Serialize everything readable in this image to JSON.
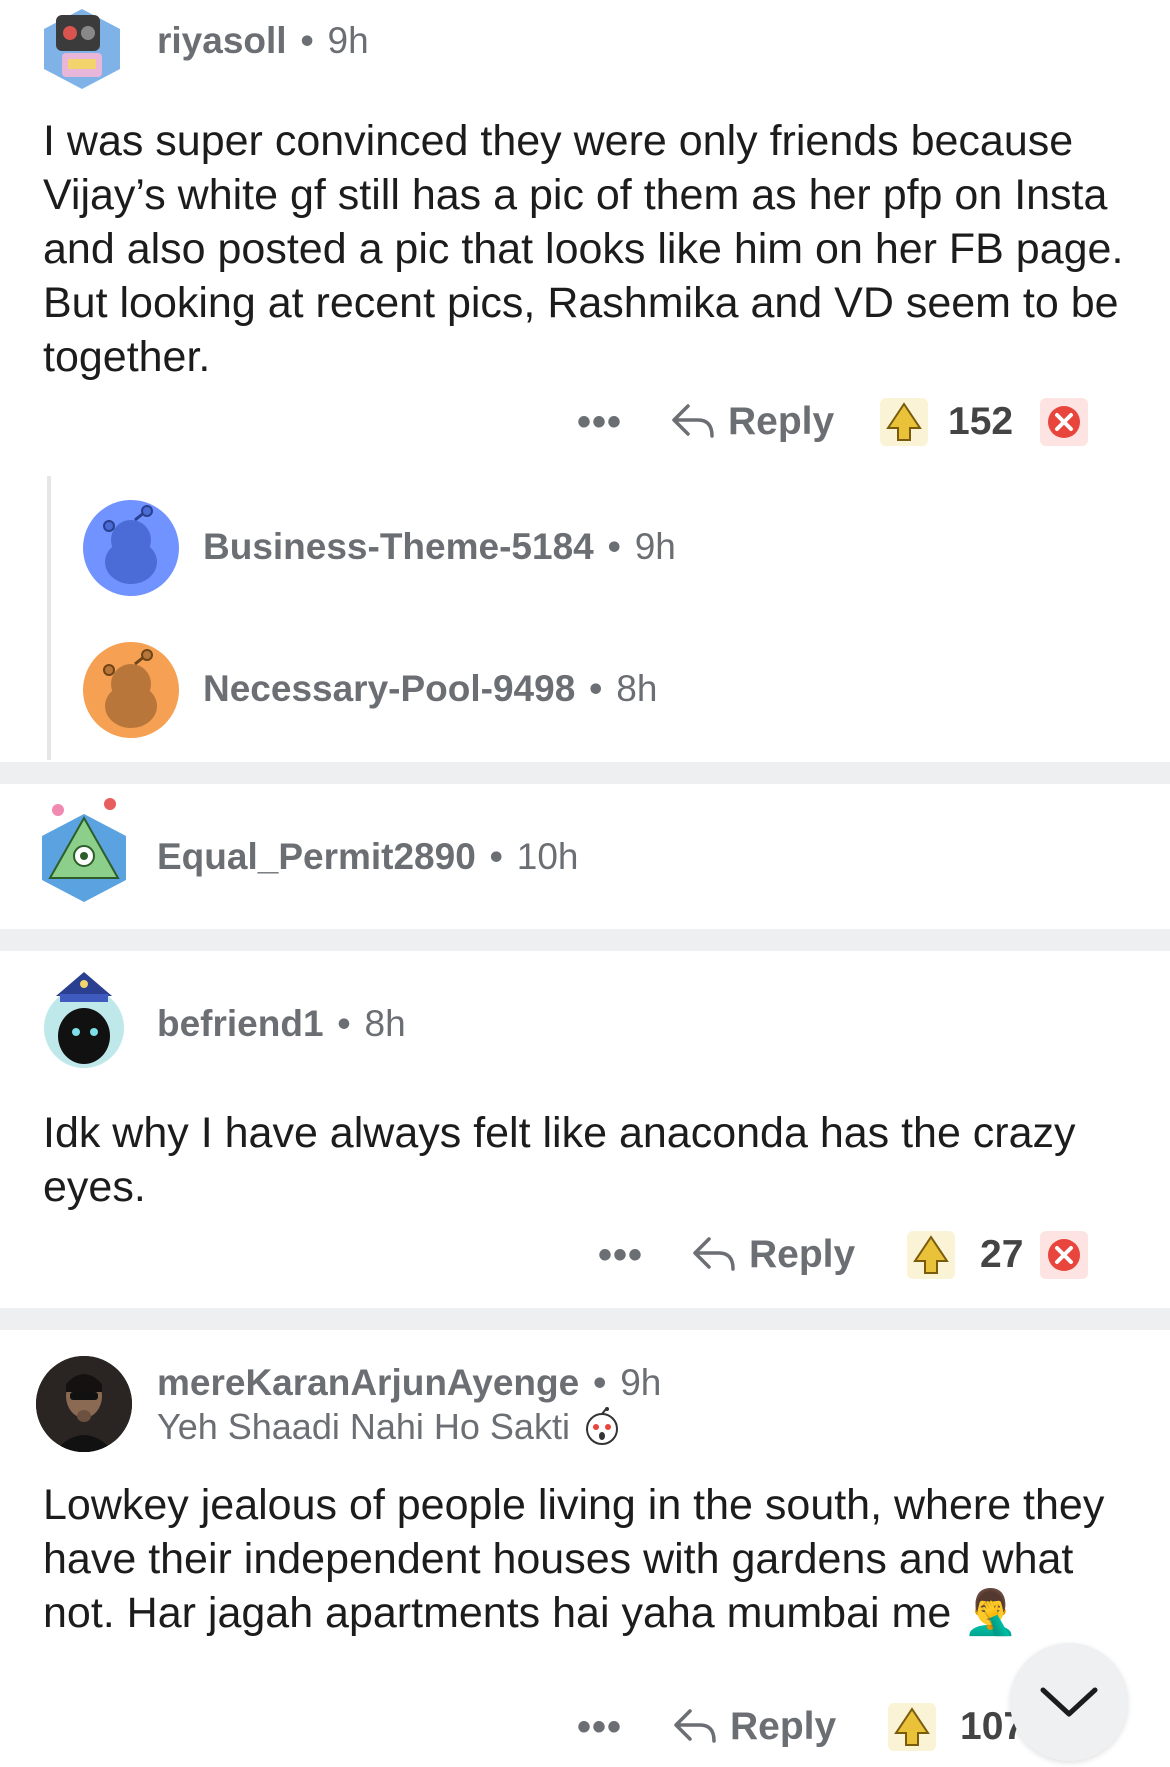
{
  "comments": [
    {
      "username": "riyasoll",
      "time": "9h",
      "body": "I was super convinced they were only friends because Vijay’s white gf still has a pic of them as her pfp on Insta and also posted a pic that looks like him on her FB page. But looking at recent pics, Rashmika and VD seem to be together.",
      "more": "•••",
      "reply_label": "Reply",
      "votes": "152"
    },
    {
      "username": "Business-Theme-5184",
      "time": "9h",
      "avatar_color": "#7193ff"
    },
    {
      "username": "Necessary-Pool-9498",
      "time": "8h",
      "avatar_color": "#f5a052"
    },
    {
      "username": "Equal_Permit2890",
      "time": "10h"
    },
    {
      "username": "befriend1",
      "time": "8h",
      "body": "Idk why I have always felt like anaconda has the crazy eyes.",
      "more": "•••",
      "reply_label": "Reply",
      "votes": "27"
    },
    {
      "username": "mereKaranArjunAyenge",
      "time": "9h",
      "flair": "Yeh Shaadi Nahi Ho Sakti",
      "body": "Lowkey jealous of people living in the south, where they have their independent houses with gardens and what not. Har jagah apartments hai yaha mumbai me",
      "body_emoji": "🤦‍♂️",
      "more": "•••",
      "reply_label": "Reply",
      "votes": "107"
    }
  ],
  "dot": "•",
  "icons": {
    "reply": "reply-arrow-icon",
    "upvote": "upvote-award-icon",
    "downvote": "downvote-award-icon",
    "scroll": "chevron-down-icon"
  },
  "colors": {
    "separator": "#eeeff0",
    "meta_text": "#6b6f73",
    "downvote_red": "#e8453c",
    "upvote_gold": "#e9c23a"
  }
}
